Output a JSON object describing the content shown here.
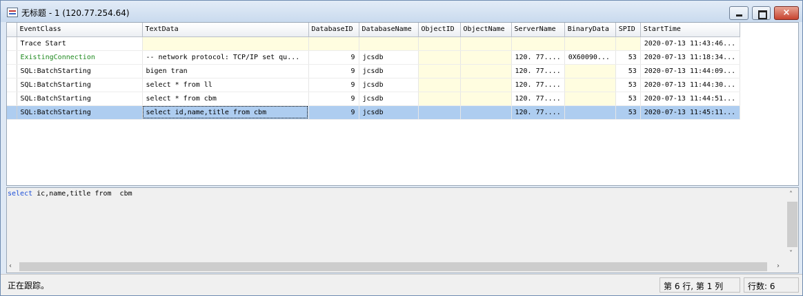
{
  "window": {
    "title": "无标题 - 1 (120.77.254.64)",
    "close_glyph": "×"
  },
  "grid": {
    "columns": [
      "EventClass",
      "TextData",
      "DatabaseID",
      "DatabaseName",
      "ObjectID",
      "ObjectName",
      "ServerName",
      "BinaryData",
      "SPID",
      "StartTime"
    ],
    "rows": [
      {
        "EventClass": "Trace Start",
        "TextData": "",
        "DatabaseID": "",
        "DatabaseName": "",
        "ObjectID": "",
        "ObjectName": "",
        "ServerName": "",
        "BinaryData": "",
        "SPID": "",
        "StartTime": "2020-07-13 11:43:46..."
      },
      {
        "EventClass": "ExistingConnection",
        "TextData": "-- network protocol: TCP/IP  set qu...",
        "DatabaseID": "9",
        "DatabaseName": "jcsdb",
        "ObjectID": "",
        "ObjectName": "",
        "ServerName": "120. 77....",
        "BinaryData": "0X60090...",
        "SPID": "53",
        "StartTime": "2020-07-13 11:18:34..."
      },
      {
        "EventClass": "SQL:BatchStarting",
        "TextData": "bigen tran",
        "DatabaseID": "9",
        "DatabaseName": "jcsdb",
        "ObjectID": "",
        "ObjectName": "",
        "ServerName": "120. 77....",
        "BinaryData": "",
        "SPID": "53",
        "StartTime": "2020-07-13 11:44:09..."
      },
      {
        "EventClass": "SQL:BatchStarting",
        "TextData": "select * from  ll",
        "DatabaseID": "9",
        "DatabaseName": "jcsdb",
        "ObjectID": "",
        "ObjectName": "",
        "ServerName": "120. 77....",
        "BinaryData": "",
        "SPID": "53",
        "StartTime": "2020-07-13 11:44:30..."
      },
      {
        "EventClass": "SQL:BatchStarting",
        "TextData": "select * from  cbm",
        "DatabaseID": "9",
        "DatabaseName": "jcsdb",
        "ObjectID": "",
        "ObjectName": "",
        "ServerName": "120. 77....",
        "BinaryData": "",
        "SPID": "53",
        "StartTime": "2020-07-13 11:44:51..."
      },
      {
        "EventClass": "SQL:BatchStarting",
        "TextData": "select id,name,title from  cbm",
        "DatabaseID": "9",
        "DatabaseName": "jcsdb",
        "ObjectID": "",
        "ObjectName": "",
        "ServerName": "120. 77....",
        "BinaryData": "",
        "SPID": "53",
        "StartTime": "2020-07-13 11:45:11..."
      }
    ],
    "selected_row": 6
  },
  "detail": {
    "keyword": "select",
    "rest": " ic,name,title from  cbm"
  },
  "status": {
    "text": "正在跟踪。",
    "position": "第 6 行, 第 1 列",
    "row_count": "行数: 6"
  },
  "colors": {
    "selection": "#aecdf0",
    "empty_cell": "#fffde0",
    "existing_connection": "#1f8a1f",
    "sql_keyword": "#1c4fd8"
  },
  "icons": [
    "app-icon",
    "minimize-icon",
    "maximize-icon",
    "close-icon",
    "scroll-up-icon",
    "scroll-down-icon",
    "scroll-left-icon",
    "scroll-right-icon"
  ]
}
